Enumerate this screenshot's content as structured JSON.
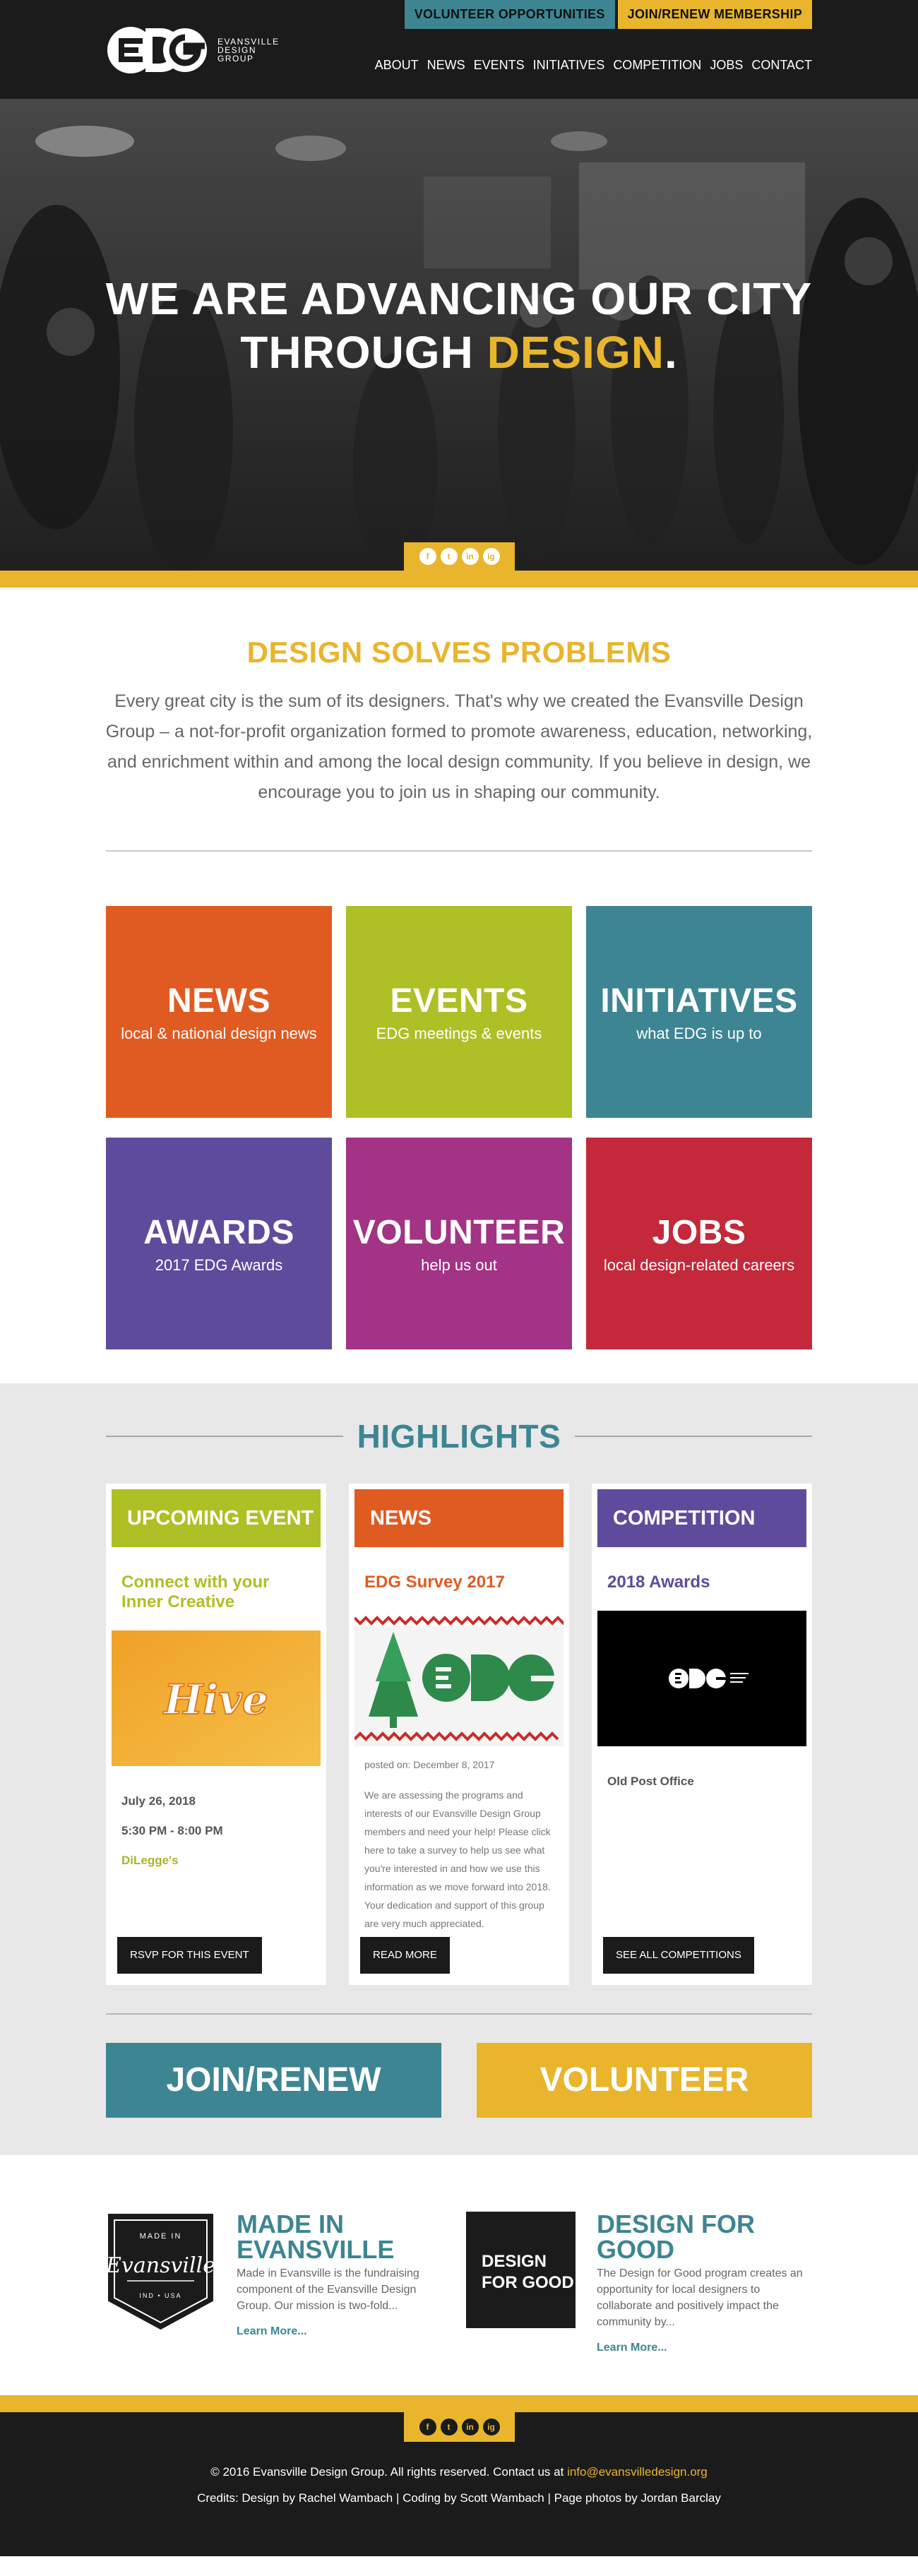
{
  "header": {
    "volunteer_btn": "VOLUNTEER OPPORTUNITIES",
    "join_btn": "JOIN/RENEW MEMBERSHIP",
    "logo_line1": "EVANSVILLE",
    "logo_line2": "DESIGN",
    "logo_line3": "GROUP",
    "nav": [
      "ABOUT",
      "NEWS",
      "EVENTS",
      "INITIATIVES",
      "COMPETITION",
      "JOBS",
      "CONTACT"
    ]
  },
  "hero": {
    "line1": "WE ARE ADVANCING OUR CITY",
    "line2_prefix": "THROUGH ",
    "line2_highlight": "DESIGN",
    "line2_suffix": "."
  },
  "social": [
    "f",
    "t",
    "in",
    "ig"
  ],
  "intro": {
    "title": "DESIGN SOLVES PROBLEMS",
    "body": "Every great city is the sum of its designers. That's why we created the Evansville Design Group – a not-for-profit organization formed to promote awareness, education, networking, and enrichment within and among the local design community. If you believe in design, we encourage you to join us in shaping our community."
  },
  "tiles": [
    {
      "title": "NEWS",
      "sub": "local & national design news",
      "color": "#e05b22"
    },
    {
      "title": "EVENTS",
      "sub": "EDG meetings & events",
      "color": "#afbf26"
    },
    {
      "title": "INITIATIVES",
      "sub": "what EDG is up to",
      "color": "#3d8593"
    },
    {
      "title": "AWARDS",
      "sub": "2017 EDG Awards",
      "color": "#5f4b9b"
    },
    {
      "title": "VOLUNTEER",
      "sub": "help us out",
      "color": "#a23385"
    },
    {
      "title": "JOBS",
      "sub": "local design-related careers",
      "color": "#c3293a"
    }
  ],
  "highlights": {
    "title": "HIGHLIGHTS",
    "event": {
      "head": "UPCOMING EVENT",
      "title": "Connect with your Inner Creative",
      "img_text": "Hive",
      "date": "July 26, 2018",
      "time": "5:30 PM - 8:00 PM",
      "location": "DiLegge's",
      "btn": "RSVP FOR THIS EVENT",
      "color": "#afbf26"
    },
    "news": {
      "head": "NEWS",
      "title": "EDG Survey 2017",
      "posted": "posted on: December 8, 2017",
      "body": "We are assessing the programs and interests of our Evansville Design Group members and need your help! Please click here to take a survey to help us see what you're interested in and how we use this information as we move forward into 2018. Your dedication and support of this group are very much appreciated.",
      "btn": "READ MORE",
      "color": "#e05b22"
    },
    "competition": {
      "head": "COMPETITION",
      "title": "2018 Awards",
      "location": "Old Post Office",
      "btn": "SEE ALL COMPETITIONS",
      "color": "#5f4b9b"
    },
    "join_btn": "JOIN/RENEW",
    "volunteer_btn": "VOLUNTEER"
  },
  "programs": {
    "made": {
      "title": "MADE IN EVANSVILLE",
      "body": "Made in Evansville is the fundraising component of the Evansville Design Group. Our mission is two-fold...",
      "link": "Learn More...",
      "badge_top": "MADE IN",
      "badge_script": "Evansville",
      "badge_bottom": "IND • USA"
    },
    "good": {
      "title": "DESIGN FOR GOOD",
      "body": "The Design for Good program creates an opportunity for local designers to collaborate and positively impact the community by...",
      "link": "Learn More...",
      "box_line1": "DESIGN",
      "box_line2": "FOR GOOD"
    }
  },
  "footer": {
    "copy": "© 2016 Evansville Design Group. All rights reserved. Contact us at ",
    "email": "info@evansvilledesign.org",
    "credits": "Credits: Design by Rachel Wambach | Coding by Scott Wambach | Page photos by Jordan Barclay"
  },
  "colors": {
    "yellow": "#e8b52c",
    "teal": "#3d8593",
    "dark": "#1b1b1b"
  }
}
